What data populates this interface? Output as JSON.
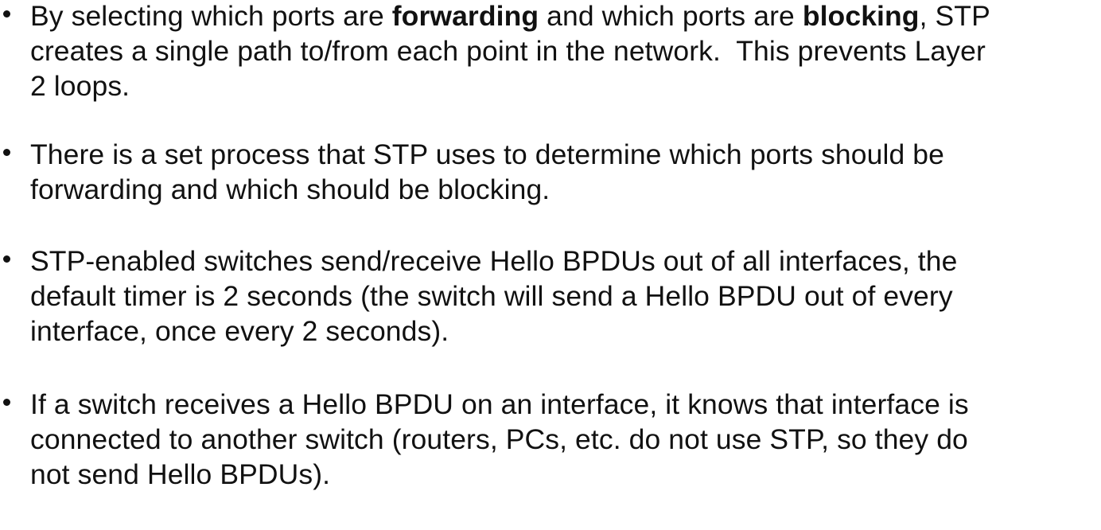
{
  "bullets": [
    {
      "lines": [
        {
          "segments": [
            {
              "text": "By selecting which ports are "
            },
            {
              "text": "forwarding",
              "bold": true
            },
            {
              "text": " and which ports are "
            },
            {
              "text": "blocking",
              "bold": true
            },
            {
              "text": ", STP"
            }
          ]
        },
        {
          "segments": [
            {
              "text": "creates a single path to/from each point in the network.  This prevents Layer"
            }
          ]
        },
        {
          "segments": [
            {
              "text": "2 loops."
            }
          ]
        }
      ]
    },
    {
      "lines": [
        {
          "segments": [
            {
              "text": "There is a set process that STP uses to determine which ports should be"
            }
          ]
        },
        {
          "segments": [
            {
              "text": "forwarding and which should be blocking."
            }
          ]
        }
      ]
    },
    {
      "lines": [
        {
          "segments": [
            {
              "text": "STP-enabled switches send/receive Hello BPDUs out of all interfaces, the"
            }
          ]
        },
        {
          "segments": [
            {
              "text": "default timer is 2 seconds (the switch will send a Hello BPDU out of every"
            }
          ]
        },
        {
          "segments": [
            {
              "text": "interface, once every 2 seconds)."
            }
          ]
        }
      ]
    },
    {
      "lines": [
        {
          "segments": [
            {
              "text": "If a switch receives a Hello BPDU on an interface, it knows that interface is"
            }
          ]
        },
        {
          "segments": [
            {
              "text": "connected to another switch (routers, PCs, etc. do not use STP, so they do"
            }
          ]
        },
        {
          "segments": [
            {
              "text": "not send Hello BPDUs)."
            }
          ]
        }
      ]
    }
  ]
}
